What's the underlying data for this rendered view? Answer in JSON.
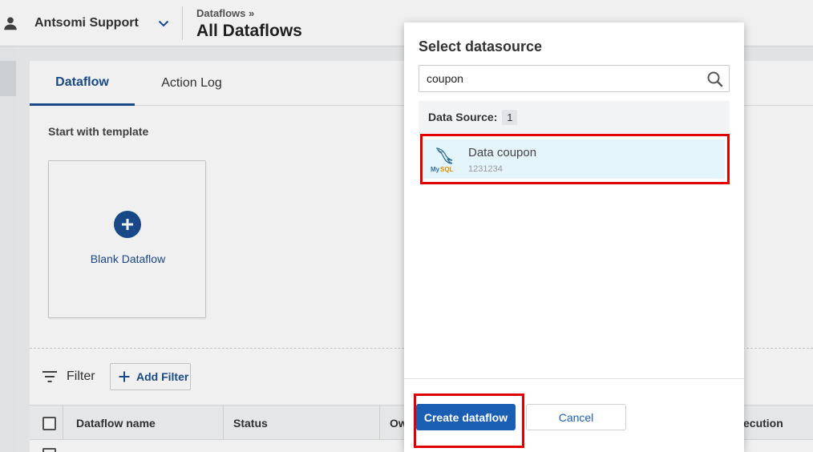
{
  "header": {
    "account_name": "Antsomi Support",
    "breadcrumb": "Dataflows »",
    "title": "All Dataflows"
  },
  "tabs": [
    {
      "label": "Dataflow",
      "active": true
    },
    {
      "label": "Action Log",
      "active": false
    }
  ],
  "templates": {
    "heading": "Start with template",
    "blank_label": "Blank Dataflow"
  },
  "filter": {
    "label": "Filter",
    "add_label": "Add Filter"
  },
  "table": {
    "columns": [
      "Dataflow name",
      "Status",
      "Ow",
      "ecution"
    ]
  },
  "modal": {
    "title": "Select datasource",
    "search_value": "coupon",
    "group_label": "Data Source:",
    "group_count": "1",
    "items": [
      {
        "name": "Data coupon",
        "id": "1231234",
        "icon": "mysql-logo-icon",
        "selected": true
      }
    ],
    "create_label": "Create dataflow",
    "cancel_label": "Cancel"
  },
  "colors": {
    "primary": "#1a4d8f",
    "button_blue": "#1a5fb4",
    "highlight": "#e00000",
    "selected_row": "#e4f4fb"
  }
}
